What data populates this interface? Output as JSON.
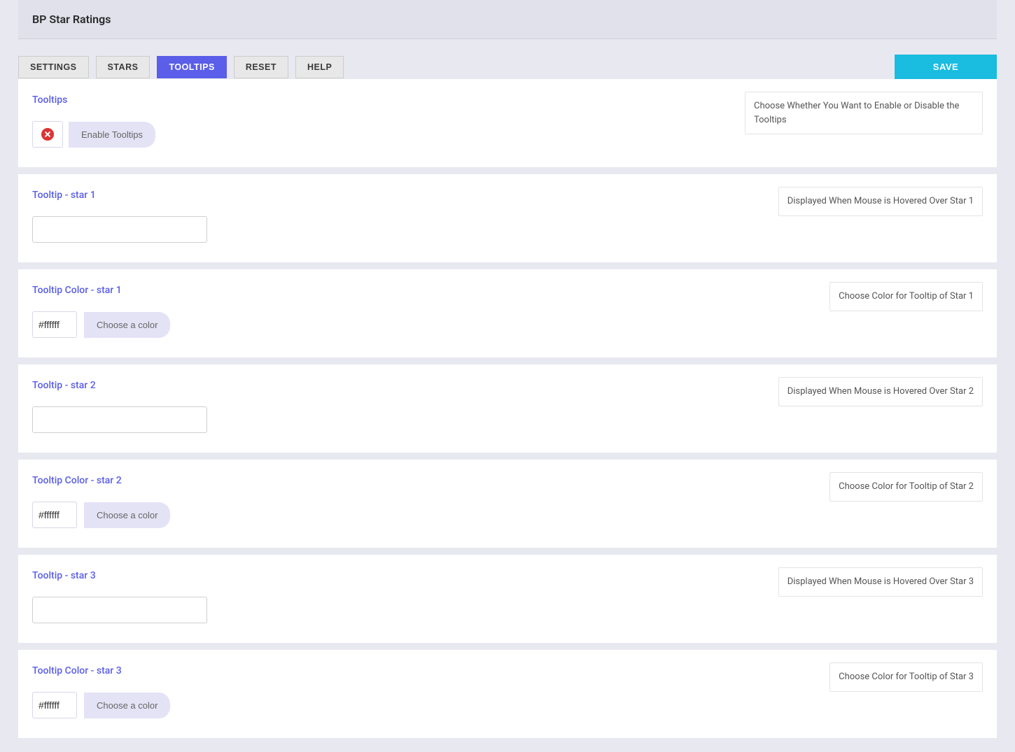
{
  "header": {
    "title": "BP Star Ratings"
  },
  "tabs": {
    "items": [
      {
        "label": "SETTINGS",
        "active": false
      },
      {
        "label": "STARS",
        "active": false
      },
      {
        "label": "TOOLTIPS",
        "active": true
      },
      {
        "label": "RESET",
        "active": false
      },
      {
        "label": "HELP",
        "active": false
      }
    ]
  },
  "save_label": "SAVE",
  "sections": {
    "tooltips_enable": {
      "title": "Tooltips",
      "help": "Choose Whether You Want to Enable or Disable the Tooltips",
      "button_label": "Enable Tooltips"
    },
    "star1_text": {
      "title": "Tooltip - star 1",
      "help": "Displayed When Mouse is Hovered Over Star 1",
      "value": ""
    },
    "star1_color": {
      "title": "Tooltip Color - star 1",
      "help": "Choose Color for Tooltip of Star 1",
      "value": "#ffffff",
      "button_label": "Choose a color"
    },
    "star2_text": {
      "title": "Tooltip - star 2",
      "help": "Displayed When Mouse is Hovered Over Star 2",
      "value": ""
    },
    "star2_color": {
      "title": "Tooltip Color - star 2",
      "help": "Choose Color for Tooltip of Star 2",
      "value": "#ffffff",
      "button_label": "Choose a color"
    },
    "star3_text": {
      "title": "Tooltip - star 3",
      "help": "Displayed When Mouse is Hovered Over Star 3",
      "value": ""
    },
    "star3_color": {
      "title": "Tooltip Color - star 3",
      "help": "Choose Color for Tooltip of Star 3",
      "value": "#ffffff",
      "button_label": "Choose a color"
    }
  }
}
